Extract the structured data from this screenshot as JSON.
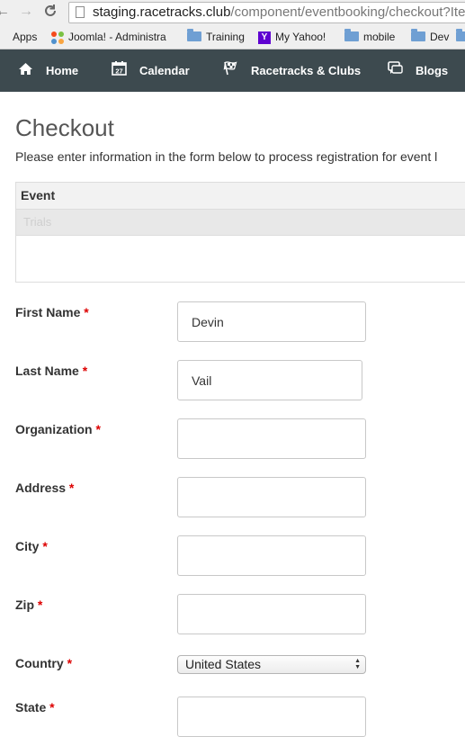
{
  "browser": {
    "url_host": "staging.racetracks.club",
    "url_path": "/component/eventbooking/checkout?Ite",
    "bookmarks": [
      {
        "label": "Apps",
        "icon": "apps-grid-icon"
      },
      {
        "label": "Joomla! - Administra",
        "icon": "joomla-icon"
      },
      {
        "label": "Training",
        "icon": "folder-icon"
      },
      {
        "label": "My Yahoo!",
        "icon": "yahoo-icon"
      },
      {
        "label": "mobile",
        "icon": "folder-icon"
      },
      {
        "label": "Dev",
        "icon": "folder-icon"
      }
    ]
  },
  "nav": {
    "items": [
      {
        "label": "Home",
        "icon": "home-icon"
      },
      {
        "label": "Calendar",
        "icon": "calendar-icon",
        "icon_text": "27"
      },
      {
        "label": "Racetracks & Clubs",
        "icon": "checkered-flag-icon"
      },
      {
        "label": "Blogs",
        "icon": "speech-bubble-icon"
      }
    ],
    "background": "#3d4a4f"
  },
  "page": {
    "title": "Checkout",
    "intro": "Please enter information in the form below to process registration for event l"
  },
  "event_table": {
    "header": "Event",
    "row": "Trials"
  },
  "form": {
    "required_marker": "*",
    "fields": [
      {
        "label": "First Name",
        "value": "Devin"
      },
      {
        "label": "Last Name",
        "value": "Vail"
      },
      {
        "label": "Organization",
        "value": ""
      },
      {
        "label": "Address",
        "value": ""
      },
      {
        "label": "City",
        "value": ""
      },
      {
        "label": "Zip",
        "value": ""
      },
      {
        "label": "Country",
        "value": "United States"
      },
      {
        "label": "State",
        "value": ""
      }
    ]
  },
  "colors": {
    "required": "#dd0000",
    "title": "#555555"
  }
}
